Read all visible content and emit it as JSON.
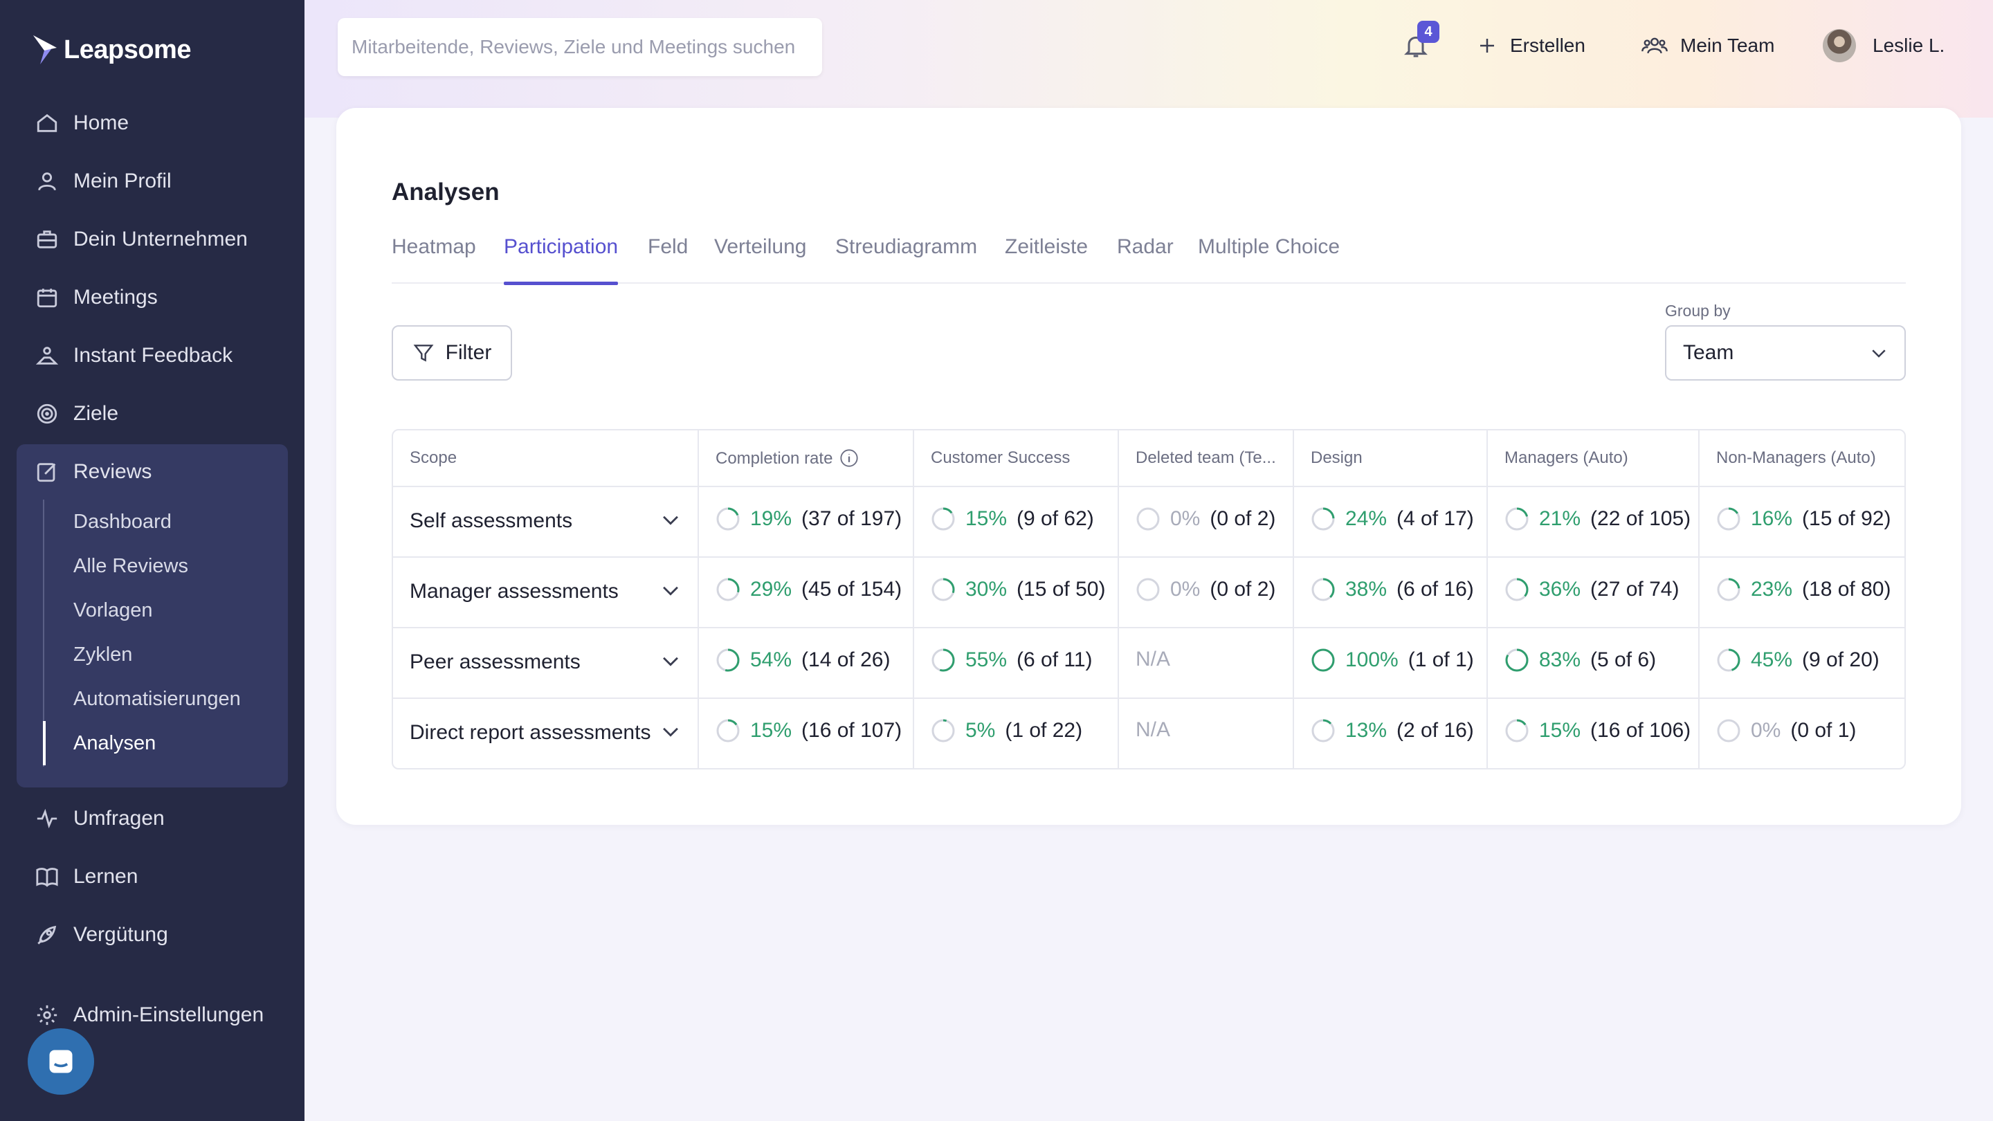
{
  "app": {
    "logo_text": "Leapsome"
  },
  "search": {
    "placeholder": "Mitarbeitende, Reviews, Ziele und Meetings suchen"
  },
  "topbar": {
    "notification_count": "4",
    "create_label": "Erstellen",
    "team_label": "Mein Team",
    "user_name": "Leslie L."
  },
  "sidebar": {
    "items": [
      {
        "label": "Home",
        "icon": "home-icon"
      },
      {
        "label": "Mein Profil",
        "icon": "user-icon"
      },
      {
        "label": "Dein Unternehmen",
        "icon": "briefcase-icon"
      },
      {
        "label": "Meetings",
        "icon": "calendar-icon"
      },
      {
        "label": "Instant Feedback",
        "icon": "feedback-icon"
      },
      {
        "label": "Ziele",
        "icon": "target-icon"
      },
      {
        "label": "Reviews",
        "icon": "edit-icon"
      },
      {
        "label": "Umfragen",
        "icon": "pulse-icon"
      },
      {
        "label": "Lernen",
        "icon": "book-icon"
      },
      {
        "label": "Vergütung",
        "icon": "rocket-icon"
      },
      {
        "label": "Admin-Einstellungen",
        "icon": "gear-icon"
      }
    ],
    "reviews_sub": [
      "Dashboard",
      "Alle Reviews",
      "Vorlagen",
      "Zyklen",
      "Automatisierungen",
      "Analysen"
    ]
  },
  "page": {
    "title": "Analysen",
    "tabs": [
      "Heatmap",
      "Participation",
      "Feld",
      "Verteilung",
      "Streudiagramm",
      "Zeitleiste",
      "Radar",
      "Multiple Choice"
    ],
    "active_tab": "Participation",
    "filter_label": "Filter",
    "group_by_label": "Group by",
    "group_by_value": "Team"
  },
  "table": {
    "headers": [
      "Scope",
      "Completion rate",
      "Customer Success",
      "Deleted team (Te...",
      "Design",
      "Managers (Auto)",
      "Non-Managers (Auto)"
    ],
    "rows": [
      {
        "scope": "Self assessments",
        "cells": [
          {
            "pct": "19%",
            "count": "(37 of 197)",
            "value": 0.19
          },
          {
            "pct": "15%",
            "count": "(9 of 62)",
            "value": 0.15
          },
          {
            "pct": "0%",
            "count": "(0 of 2)",
            "value": 0
          },
          {
            "pct": "24%",
            "count": "(4 of 17)",
            "value": 0.24
          },
          {
            "pct": "21%",
            "count": "(22 of 105)",
            "value": 0.21
          },
          {
            "pct": "16%",
            "count": "(15 of 92)",
            "value": 0.16
          }
        ]
      },
      {
        "scope": "Manager assessments",
        "cells": [
          {
            "pct": "29%",
            "count": "(45 of 154)",
            "value": 0.29
          },
          {
            "pct": "30%",
            "count": "(15 of 50)",
            "value": 0.3
          },
          {
            "pct": "0%",
            "count": "(0 of 2)",
            "value": 0
          },
          {
            "pct": "38%",
            "count": "(6 of 16)",
            "value": 0.38
          },
          {
            "pct": "36%",
            "count": "(27 of 74)",
            "value": 0.36
          },
          {
            "pct": "23%",
            "count": "(18 of 80)",
            "value": 0.23
          }
        ]
      },
      {
        "scope": "Peer assessments",
        "cells": [
          {
            "pct": "54%",
            "count": "(14 of 26)",
            "value": 0.54
          },
          {
            "pct": "55%",
            "count": "(6 of 11)",
            "value": 0.55
          },
          {
            "na": "N/A"
          },
          {
            "pct": "100%",
            "count": "(1 of 1)",
            "value": 1.0
          },
          {
            "pct": "83%",
            "count": "(5 of 6)",
            "value": 0.83
          },
          {
            "pct": "45%",
            "count": "(9 of 20)",
            "value": 0.45
          }
        ]
      },
      {
        "scope": "Direct report assessments",
        "cells": [
          {
            "pct": "15%",
            "count": "(16 of 107)",
            "value": 0.15
          },
          {
            "pct": "5%",
            "count": "(1 of 22)",
            "value": 0.05
          },
          {
            "na": "N/A"
          },
          {
            "pct": "13%",
            "count": "(2 of 16)",
            "value": 0.13
          },
          {
            "pct": "15%",
            "count": "(16 of 106)",
            "value": 0.15
          },
          {
            "pct": "0%",
            "count": "(0 of 1)",
            "value": 0
          }
        ]
      }
    ]
  },
  "colors": {
    "accent": "#5650cf",
    "progress": "#2f9e6e",
    "sidebar_bg": "#262a45"
  }
}
